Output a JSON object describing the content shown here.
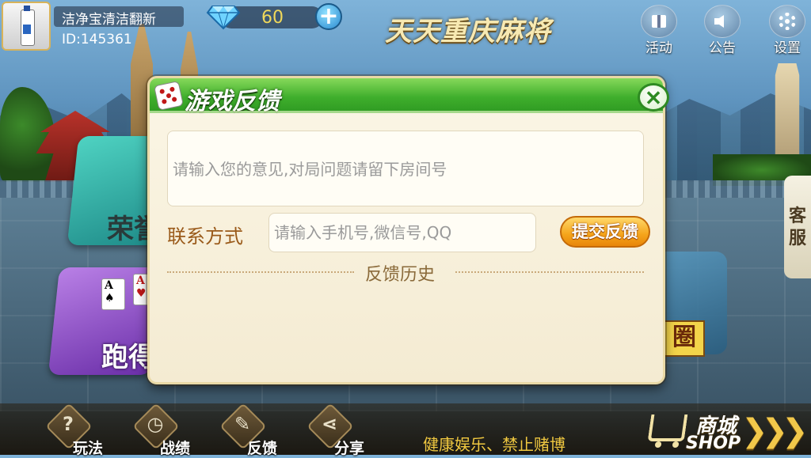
{
  "player": {
    "nickname": "洁净宝清洁翻新",
    "id": "ID:145361"
  },
  "currency": {
    "diamonds": "60",
    "add_label": "+"
  },
  "app": {
    "title": "天天重庆麻将"
  },
  "top_menu": [
    {
      "label": "活动",
      "icon": "gift-icon"
    },
    {
      "label": "公告",
      "icon": "speaker-icon"
    },
    {
      "label": "设置",
      "icon": "gear-icon"
    }
  ],
  "background": {
    "card_left_top": "荣誉",
    "card_left_bottom": "跑得快",
    "card_right_badge": "圈",
    "service_tab": [
      "客",
      "服"
    ]
  },
  "feedback_dialog": {
    "title": "游戏反馈",
    "close_label": "✕",
    "opinion_placeholder": "请输入您的意见,对局问题请留下房间号",
    "contact_label": "联系方式",
    "contact_placeholder": "请输入手机号,微信号,QQ",
    "submit_label": "提交反馈",
    "history_title": "反馈历史"
  },
  "bottom_menu": [
    {
      "label": "玩法",
      "glyph": "?",
      "icon": "question-icon"
    },
    {
      "label": "战绩",
      "glyph": "◷",
      "icon": "record-icon"
    },
    {
      "label": "反馈",
      "glyph": "✎",
      "icon": "pencil-icon"
    },
    {
      "label": "分享",
      "glyph": "⋖",
      "icon": "share-icon"
    }
  ],
  "slogan": "健康娱乐、禁止赌博",
  "shop": {
    "label_cn": "商城",
    "label_en": "SHOP",
    "arrows": "❯❯❯"
  },
  "colors": {
    "dialog_header": "#3fae2c",
    "submit_button": "#f5a41a",
    "slogan": "#f0c840",
    "title_gold": "#f7e9b2"
  }
}
